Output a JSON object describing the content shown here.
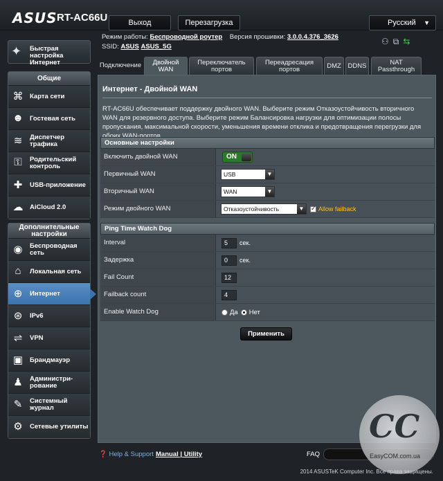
{
  "header": {
    "brand": "ASUS",
    "model": "RT-AC66U",
    "logout": "Выход",
    "reboot": "Перезагрузка",
    "language": "Русский"
  },
  "info": {
    "mode_label": "Режим работы:",
    "mode_value": "Беспроводной роутер",
    "fw_label": "Версия прошивки:",
    "fw_value": "3.0.0.4.376_3626",
    "ssid_label": "SSID:",
    "ssid_1": "ASUS",
    "ssid_2": "ASUS_5G"
  },
  "sidebar": {
    "quick_setup": "Быстрая настройка Интернет",
    "general_title": "Общие",
    "general": [
      {
        "label": "Карта сети",
        "icon": "network-map-icon"
      },
      {
        "label": "Гостевая сеть",
        "icon": "guest-network-icon"
      },
      {
        "label": "Диспетчер трафика",
        "icon": "traffic-manager-icon"
      },
      {
        "label": "Родительский контроль",
        "icon": "parental-control-icon"
      },
      {
        "label": "USB-приложение",
        "icon": "usb-app-icon"
      },
      {
        "label": "AiCloud 2.0",
        "icon": "cloud-icon"
      }
    ],
    "advanced_title": "Дополнительные настройки",
    "advanced": [
      {
        "label": "Беспроводная сеть",
        "icon": "wireless-icon"
      },
      {
        "label": "Локальная сеть",
        "icon": "lan-icon"
      },
      {
        "label": "Интернет",
        "icon": "internet-icon",
        "active": true
      },
      {
        "label": "IPv6",
        "icon": "ipv6-icon"
      },
      {
        "label": "VPN",
        "icon": "vpn-icon"
      },
      {
        "label": "Брандмауэр",
        "icon": "firewall-icon"
      },
      {
        "label": "Администри-рование",
        "icon": "admin-icon"
      },
      {
        "label": "Системный журнал",
        "icon": "system-log-icon"
      },
      {
        "label": "Сетевые утилиты",
        "icon": "network-tools-icon"
      }
    ]
  },
  "tabs": [
    {
      "label": "Подключение"
    },
    {
      "label": "Двойной WAN",
      "active": true
    },
    {
      "label": "Переключатель портов"
    },
    {
      "label": "Переадресация портов"
    },
    {
      "label": "DMZ"
    },
    {
      "label": "DDNS"
    },
    {
      "label": "NAT Passthrough"
    }
  ],
  "page": {
    "title": "Интернет - Двойной WAN",
    "description": "RT-AC66U обеспечивает поддержку двойного WAN. Выберите режим Отказоустойчивость вторичного WAN для резервного доступа. Выберите режим Балансировка нагрузки для оптимизации полосы пропускания, максимальной скорости, уменьшения времени отклика и предотвращения перегрузки для обоих WAN-портов."
  },
  "basic": {
    "header": "Основные настройки",
    "enable_label": "Включить двойной WAN",
    "enable_value": "ON",
    "primary_label": "Первичный WAN",
    "primary_value": "USB",
    "secondary_label": "Вторичный WAN",
    "secondary_value": "WAN",
    "mode_label": "Режим двойного WAN",
    "mode_value": "Отказоустойчивость",
    "allow_failback": "Allow failback"
  },
  "watchdog": {
    "header": "Ping Time Watch Dog",
    "interval_label": "Interval",
    "interval_value": "5",
    "interval_unit": "сек.",
    "delay_label": "Задержка",
    "delay_value": "0",
    "delay_unit": "сек.",
    "fail_label": "Fail Count",
    "fail_value": "12",
    "failback_label": "Failback count",
    "failback_value": "4",
    "enable_label": "Enable Watch Dog",
    "yes": "Да",
    "no": "Нет"
  },
  "apply": "Применить",
  "footer": {
    "help": "Help & Support",
    "manual": "Manual",
    "separator": "|",
    "utility": "Utility",
    "faq": "FAQ",
    "copyright": "2014 ASUSTeK Computer Inc. Все права защищены."
  },
  "watermark": {
    "text": "EasyCOM.com.ua"
  }
}
